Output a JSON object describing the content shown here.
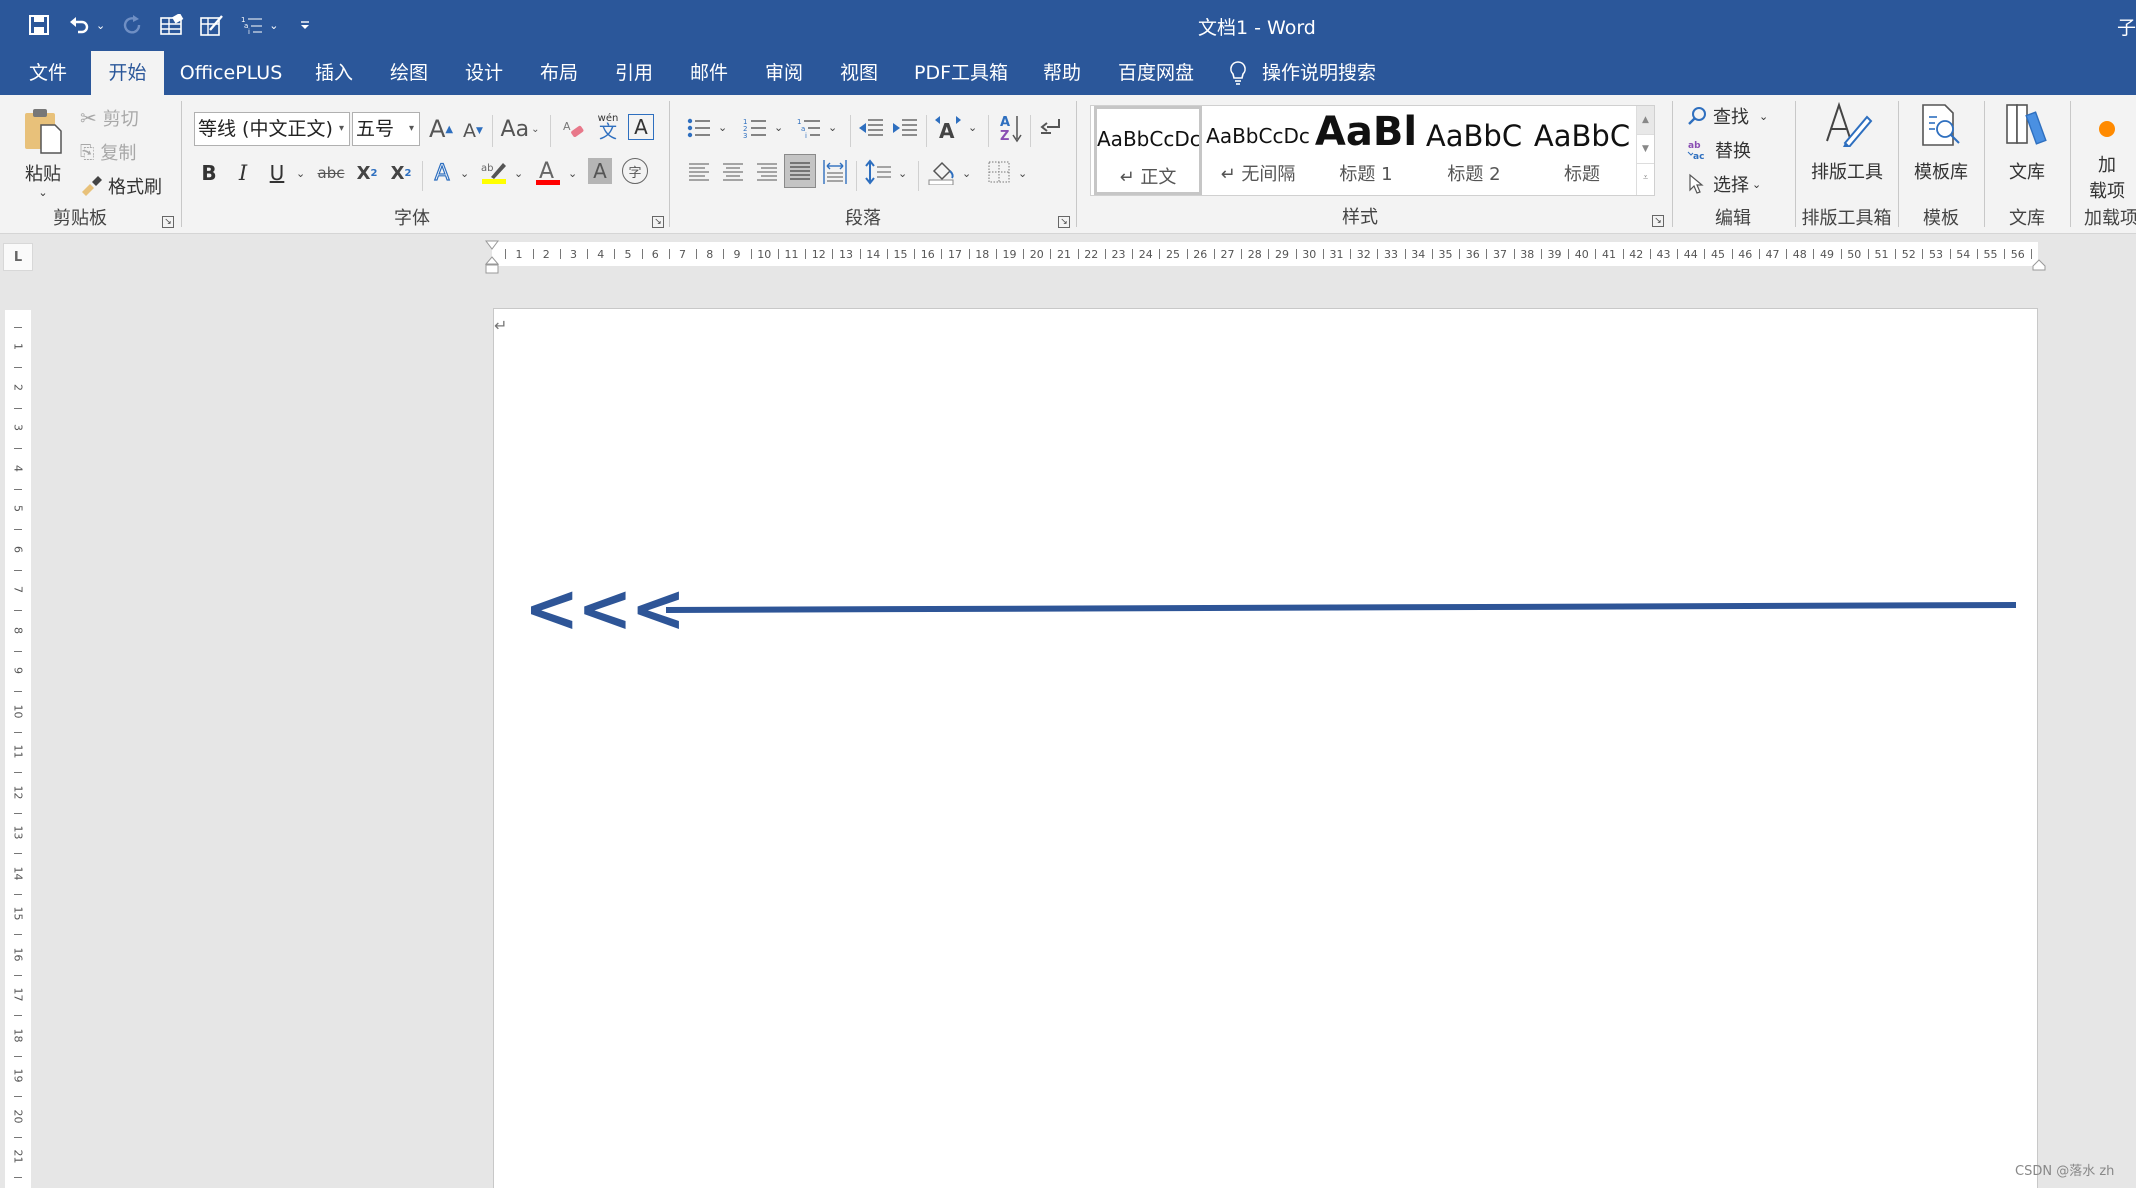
{
  "app": {
    "title": "文档1  -  Word",
    "title_right_fragment": "子"
  },
  "quick_access": [
    {
      "icon": "save-icon",
      "glyph": "💾"
    },
    {
      "icon": "undo-icon",
      "glyph": "↶"
    },
    {
      "icon": "redo-icon",
      "glyph": "↻"
    },
    {
      "icon": "table-eraser-icon",
      "glyph": "▦"
    },
    {
      "icon": "table-draw-icon",
      "glyph": "▦"
    },
    {
      "icon": "multilevel-list-icon",
      "glyph": "☰"
    },
    {
      "icon": "customize-qat-icon",
      "glyph": "⩡"
    }
  ],
  "tabs": [
    {
      "label": "文件",
      "active": false
    },
    {
      "label": "开始",
      "active": true
    },
    {
      "label": "OfficePLUS",
      "active": false
    },
    {
      "label": "插入",
      "active": false
    },
    {
      "label": "绘图",
      "active": false
    },
    {
      "label": "设计",
      "active": false
    },
    {
      "label": "布局",
      "active": false
    },
    {
      "label": "引用",
      "active": false
    },
    {
      "label": "邮件",
      "active": false
    },
    {
      "label": "审阅",
      "active": false
    },
    {
      "label": "视图",
      "active": false
    },
    {
      "label": "PDF工具箱",
      "active": false
    },
    {
      "label": "帮助",
      "active": false
    },
    {
      "label": "百度网盘",
      "active": false
    }
  ],
  "tell_me": {
    "label": "操作说明搜索",
    "icon": "lightbulb-icon"
  },
  "ribbon": {
    "clipboard": {
      "label": "剪贴板",
      "paste": "粘贴",
      "cut": "剪切",
      "copy": "复制",
      "format_painter": "格式刷"
    },
    "font": {
      "label": "字体",
      "font_name": "等线 (中文正文)",
      "font_size": "五号",
      "case_label": "Aa",
      "phonetic_top": "wén",
      "phonetic_char": "文",
      "bold": "B",
      "italic": "I",
      "underline": "U",
      "strike": "abc",
      "subscript": "X₂",
      "superscript": "X²",
      "highlight_color": "#ffff00",
      "font_color": "#ff0000",
      "enclose_char": "字"
    },
    "paragraph": {
      "label": "段落"
    },
    "styles": {
      "label": "样式",
      "items": [
        {
          "sample": "AaBbCcDc",
          "name": "↵ 正文",
          "selected": true
        },
        {
          "sample": "AaBbCcDc",
          "name": "↵ 无间隔",
          "selected": false
        },
        {
          "sample": "AaBl",
          "name": "标题 1",
          "selected": false
        },
        {
          "sample": "AaBbC",
          "name": "标题 2",
          "selected": false
        },
        {
          "sample": "AaBbC",
          "name": "标题",
          "selected": false
        }
      ]
    },
    "editing": {
      "label": "编辑",
      "find": "查找",
      "replace": "替换",
      "select": "选择"
    },
    "layout_tools": {
      "button": "排版工具",
      "label": "排版工具箱"
    },
    "templates": {
      "button": "模板库",
      "label": "模板"
    },
    "library": {
      "button": "文库",
      "label": "文库"
    },
    "addins": {
      "button_line1": "加",
      "button_line2": "载项",
      "label": "加载项"
    }
  },
  "ruler": {
    "horizontal_numbers": [
      1,
      2,
      3,
      4,
      5,
      6,
      7,
      8,
      9,
      10,
      11,
      12,
      13,
      14,
      15,
      16,
      17,
      18,
      19,
      20,
      21,
      22,
      23,
      24,
      25,
      26,
      27,
      28,
      29,
      30,
      31,
      32,
      33,
      34,
      35,
      36,
      37,
      38,
      39,
      40,
      41,
      42,
      43,
      44,
      45,
      46,
      47,
      48,
      49,
      50,
      51,
      52,
      53,
      54,
      55,
      56
    ],
    "vertical_numbers": [
      1,
      2,
      3,
      4,
      5,
      6,
      7,
      8,
      9,
      10,
      11,
      12,
      13,
      14,
      15,
      16,
      17,
      18,
      19,
      20,
      21
    ],
    "tab_selector": "L"
  },
  "document": {
    "paragraph_mark": "↵",
    "arrow_text": "<<<",
    "arrow_color": "#2e5597"
  },
  "watermark": "CSDN @落水 zh",
  "colors": {
    "brand": "#2b579a",
    "ribbon_bg": "#f3f3f3",
    "canvas_bg": "#e6e6e6"
  }
}
